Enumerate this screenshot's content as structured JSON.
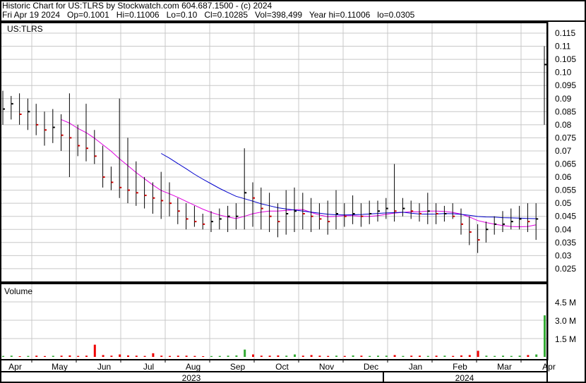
{
  "header": {
    "title": "Historic Chart for US:TLRS by Stockwatch.com 604.687.1500 - (c) 2024",
    "quote": "Fri Apr 19 2024   Op=0.1001   Hi=0.11006   Lo=0.10   Cl=0.10285   Vol=398,499   Year hi=0.11006   lo=0.0305"
  },
  "chart_data": {
    "type": "bar",
    "symbol_label": "US:TLRS",
    "volume_label": "Volume",
    "price_ticks": [
      "0.115",
      "0.11",
      "0.105",
      "0.10",
      "0.095",
      "0.09",
      "0.085",
      "0.08",
      "0.075",
      "0.07",
      "0.065",
      "0.06",
      "0.055",
      "0.05",
      "0.045",
      "0.04",
      "0.035",
      "0.03",
      "0.025"
    ],
    "price_range": [
      0.021,
      0.119
    ],
    "volume_ticks": [
      "4.5 M",
      "3.0 M",
      "1.5 M"
    ],
    "volume_tick_values": [
      4.5,
      3.0,
      1.5
    ],
    "months": [
      "Apr",
      "May",
      "Jun",
      "Jul",
      "Aug",
      "Sep",
      "Oct",
      "Nov",
      "Dec",
      "Jan",
      "Feb",
      "Mar",
      "Apr"
    ],
    "years": [
      "2023",
      "2024"
    ],
    "ma_windows": [
      8,
      20
    ],
    "colors": {
      "up": "#000000",
      "down": "#cc0000",
      "ma_short": "#e000e0",
      "ma_long": "#0000cc",
      "vol_up": "#33aa33",
      "vol_down": "#ee0000",
      "grid": "#c8c8c8"
    },
    "bars_lo_hi_close": [
      [
        0.08,
        0.093,
        0.086
      ],
      [
        0.082,
        0.091,
        0.088
      ],
      [
        0.08,
        0.092,
        0.084
      ],
      [
        0.078,
        0.09,
        0.085
      ],
      [
        0.076,
        0.088,
        0.08
      ],
      [
        0.072,
        0.085,
        0.078
      ],
      [
        0.073,
        0.086,
        0.079
      ],
      [
        0.07,
        0.084,
        0.076
      ],
      [
        0.06,
        0.092,
        0.075
      ],
      [
        0.068,
        0.08,
        0.072
      ],
      [
        0.066,
        0.088,
        0.071
      ],
      [
        0.065,
        0.078,
        0.068
      ],
      [
        0.056,
        0.072,
        0.06
      ],
      [
        0.055,
        0.064,
        0.058
      ],
      [
        0.052,
        0.09,
        0.056
      ],
      [
        0.05,
        0.075,
        0.055
      ],
      [
        0.049,
        0.066,
        0.054
      ],
      [
        0.048,
        0.06,
        0.053
      ],
      [
        0.046,
        0.058,
        0.052
      ],
      [
        0.044,
        0.062,
        0.051
      ],
      [
        0.045,
        0.058,
        0.05
      ],
      [
        0.042,
        0.052,
        0.047
      ],
      [
        0.04,
        0.05,
        0.044
      ],
      [
        0.041,
        0.049,
        0.043
      ],
      [
        0.04,
        0.046,
        0.042
      ],
      [
        0.039,
        0.047,
        0.043
      ],
      [
        0.04,
        0.048,
        0.044
      ],
      [
        0.039,
        0.049,
        0.045
      ],
      [
        0.04,
        0.05,
        0.045
      ],
      [
        0.04,
        0.071,
        0.054
      ],
      [
        0.041,
        0.058,
        0.052
      ],
      [
        0.04,
        0.056,
        0.048
      ],
      [
        0.039,
        0.054,
        0.045
      ],
      [
        0.037,
        0.05,
        0.043
      ],
      [
        0.038,
        0.055,
        0.046
      ],
      [
        0.039,
        0.056,
        0.047
      ],
      [
        0.04,
        0.054,
        0.046
      ],
      [
        0.039,
        0.052,
        0.045
      ],
      [
        0.04,
        0.05,
        0.044
      ],
      [
        0.038,
        0.051,
        0.043
      ],
      [
        0.04,
        0.055,
        0.046
      ],
      [
        0.041,
        0.05,
        0.045
      ],
      [
        0.042,
        0.053,
        0.046
      ],
      [
        0.041,
        0.05,
        0.045
      ],
      [
        0.042,
        0.051,
        0.046
      ],
      [
        0.043,
        0.051,
        0.047
      ],
      [
        0.044,
        0.052,
        0.048
      ],
      [
        0.043,
        0.065,
        0.047
      ],
      [
        0.045,
        0.052,
        0.048
      ],
      [
        0.044,
        0.051,
        0.047
      ],
      [
        0.043,
        0.05,
        0.046
      ],
      [
        0.042,
        0.054,
        0.047
      ],
      [
        0.042,
        0.05,
        0.046
      ],
      [
        0.043,
        0.049,
        0.046
      ],
      [
        0.044,
        0.05,
        0.045
      ],
      [
        0.038,
        0.048,
        0.042
      ],
      [
        0.034,
        0.045,
        0.039
      ],
      [
        0.031,
        0.042,
        0.036
      ],
      [
        0.035,
        0.043,
        0.04
      ],
      [
        0.038,
        0.045,
        0.042
      ],
      [
        0.039,
        0.047,
        0.042
      ],
      [
        0.04,
        0.048,
        0.043
      ],
      [
        0.04,
        0.049,
        0.044
      ],
      [
        0.039,
        0.05,
        0.043
      ],
      [
        0.036,
        0.05,
        0.044
      ],
      [
        0.08,
        0.11,
        0.103
      ]
    ],
    "volume_millions": [
      0.08,
      0.1,
      0.06,
      0.08,
      0.1,
      0.07,
      0.09,
      0.1,
      0.12,
      0.08,
      0.1,
      1.0,
      0.15,
      0.1,
      0.2,
      0.12,
      0.1,
      0.08,
      0.3,
      0.1,
      0.08,
      0.1,
      0.1,
      0.08,
      0.06,
      0.07,
      0.08,
      0.1,
      0.12,
      0.6,
      0.2,
      0.1,
      0.1,
      0.12,
      0.1,
      0.2,
      0.1,
      0.15,
      0.1,
      0.08,
      0.1,
      0.08,
      0.12,
      0.1,
      0.08,
      0.1,
      0.1,
      0.15,
      0.08,
      0.1,
      0.1,
      0.08,
      0.1,
      0.1,
      0.08,
      0.12,
      0.15,
      0.5,
      0.1,
      0.08,
      0.1,
      0.08,
      0.1,
      0.15,
      0.2,
      3.4
    ]
  }
}
